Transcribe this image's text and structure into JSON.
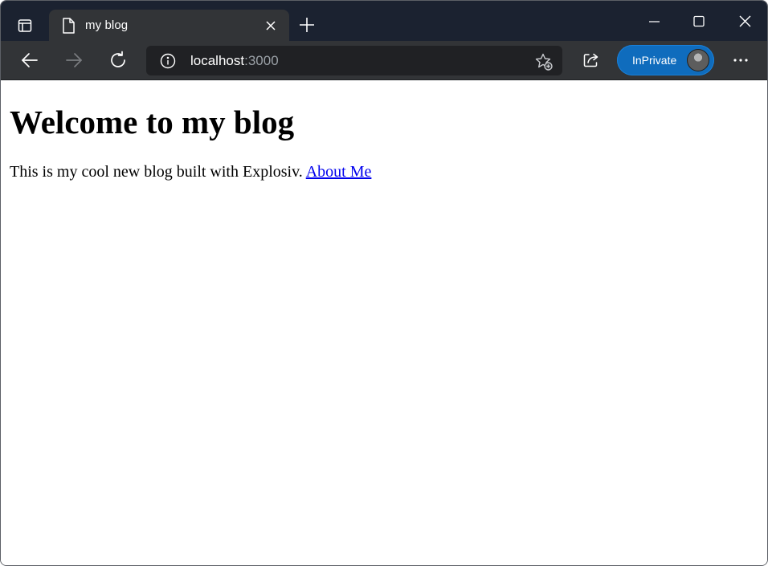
{
  "browser": {
    "tab": {
      "title": "my blog",
      "icon": "page-icon"
    },
    "address": {
      "host": "localhost",
      "port": ":3000"
    },
    "inprivate_label": "InPrivate",
    "icons": {
      "tab_actions": "tab-actions-icon",
      "close_tab": "close-icon",
      "new_tab": "plus-icon",
      "minimize": "minimize-icon",
      "maximize": "maximize-icon",
      "close_window": "close-icon",
      "back": "back-arrow-icon",
      "forward": "forward-arrow-icon",
      "refresh": "refresh-icon",
      "site_info": "info-icon",
      "add_favorite": "star-add-icon",
      "share": "share-icon",
      "more": "more-icon",
      "profile": "avatar"
    },
    "colors": {
      "titlebar": "#1b2230",
      "toolbar": "#323437",
      "address_bg": "#202124",
      "inprivate": "#0f6cbd",
      "link": "#0000ee"
    }
  },
  "page": {
    "heading": "Welcome to my blog",
    "intro": "This is my cool new blog built with Explosiv.",
    "link_label": "About Me"
  }
}
